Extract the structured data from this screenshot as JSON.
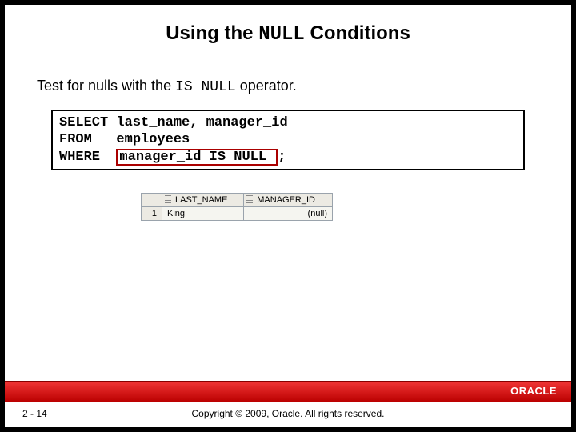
{
  "title": {
    "pre": "Using the ",
    "code": "NULL",
    "post": " Conditions"
  },
  "subtitle": {
    "pre": "Test for nulls with the ",
    "code": "IS NULL",
    "post": " operator."
  },
  "sql": {
    "line1": "SELECT last_name, manager_id",
    "line2": "FROM   employees",
    "line3_kw": "WHERE  ",
    "line3_hl": "manager_id IS NULL ",
    "line3_post": ";"
  },
  "result": {
    "headers": {
      "rownum": "",
      "c1": "LAST_NAME",
      "c2": "MANAGER_ID"
    },
    "rows": [
      {
        "n": "1",
        "last_name": "King",
        "manager_id": "(null)"
      }
    ]
  },
  "footer": {
    "logo": "ORACLE",
    "page": "2 - 14",
    "copyright": "Copyright © 2009, Oracle. All rights reserved."
  }
}
